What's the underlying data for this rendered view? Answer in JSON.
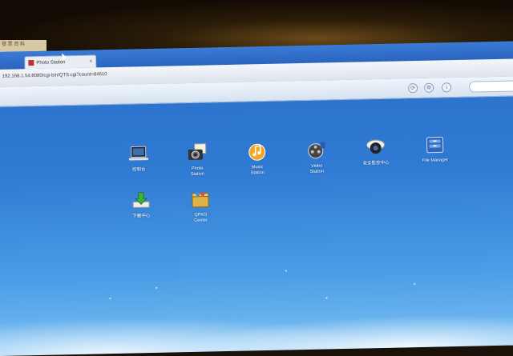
{
  "sticker": {
    "text": "發 票 資 料"
  },
  "browser": {
    "tab_title": "Photo Station",
    "url": "192.168.1.54:8080/cgi-bin/QTS.cgi?count=84610"
  },
  "apps": [
    {
      "label": "控制台",
      "icon": "laptop-icon"
    },
    {
      "label": "Photo\nStation",
      "icon": "camera-photo-icon"
    },
    {
      "label": "Music\nStation",
      "icon": "music-note-icon"
    },
    {
      "label": "Video\nStation",
      "icon": "film-reel-icon"
    },
    {
      "label": "安全監控中心",
      "icon": "security-camera-icon"
    },
    {
      "label": "File Manager",
      "icon": "file-cabinet-icon"
    },
    {
      "label": "下載中心",
      "icon": "download-arrow-icon"
    },
    {
      "label": "QPKG\nCenter",
      "icon": "package-icon"
    }
  ]
}
